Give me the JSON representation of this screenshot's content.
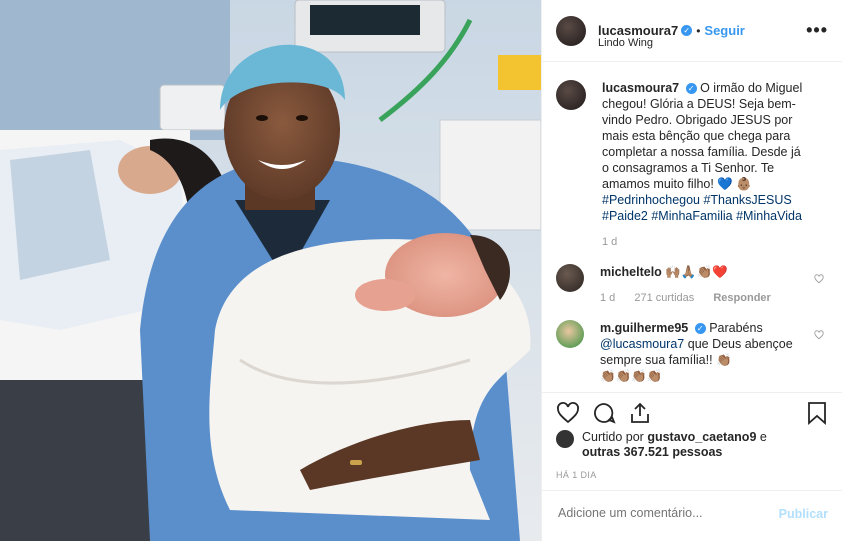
{
  "post": {
    "username": "lucasmoura7",
    "follow": "Seguir",
    "location": "Lindo Wing",
    "separator": "•",
    "more": "•••"
  },
  "caption": {
    "username": "lucasmoura7",
    "text": "O irmão do Miguel chegou! Glória a DEUS! Seja bem-vindo Pedro. Obrigado JESUS por mais esta bênção que chega para completar a nossa família. Desde já o consagramos a Ti Senhor. Te amamos muito filho! 💙 👶🏽",
    "hashtags": "#Pedrinhochegou #ThanksJESUS #Paide2 #MinhaFamilia #MinhaVida",
    "time": "1 d"
  },
  "comments": [
    {
      "username": "micheltelo",
      "text": "🙌🏽🙏🏽👏🏽❤️",
      "time": "1 d",
      "likes": "271 curtidas",
      "reply": "Responder"
    },
    {
      "username": "m.guilherme95",
      "text_prefix": "Parabéns",
      "mention": "@lucasmoura7",
      "text": " que Deus abençoe sempre sua família!! 👏🏽",
      "cut_emojis": "👏🏽👏🏽👏🏽👏🏽"
    }
  ],
  "likes": {
    "prefix": "Curtido por",
    "user": "gustavo_caetano9",
    "suffix": " e",
    "others": "outras 367.521 pessoas"
  },
  "ago": "HÁ 1 DIA",
  "add_comment": {
    "placeholder": "Adicione um comentário...",
    "publish": "Publicar"
  },
  "colors": {
    "link": "#3897f0",
    "hashtag": "#003569",
    "muted": "#999999",
    "publish_disabled": "#b2dffc"
  }
}
